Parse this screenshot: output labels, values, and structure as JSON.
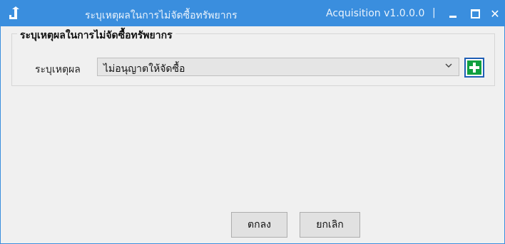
{
  "window": {
    "title": "ระบุเหตุผลในการไม่จัดซื้อทรัพยากร",
    "app_version": "Acquisition v1.0.0.0",
    "separator": "|",
    "close_glyph": "✕"
  },
  "group": {
    "title": "ระบุเหตุผลในการไม่จัดซื้อทรัพยากร"
  },
  "form": {
    "reason_label": "ระบุเหตุผล",
    "reason_value": "ไม่อนุญาตให้จัดซื้อ"
  },
  "buttons": {
    "ok_label": "ตกลง",
    "cancel_label": "ยกเลิก"
  },
  "colors": {
    "titlebar": "#3a8ede",
    "add_button_green": "#10a040",
    "add_button_border": "#1f5fb5"
  }
}
